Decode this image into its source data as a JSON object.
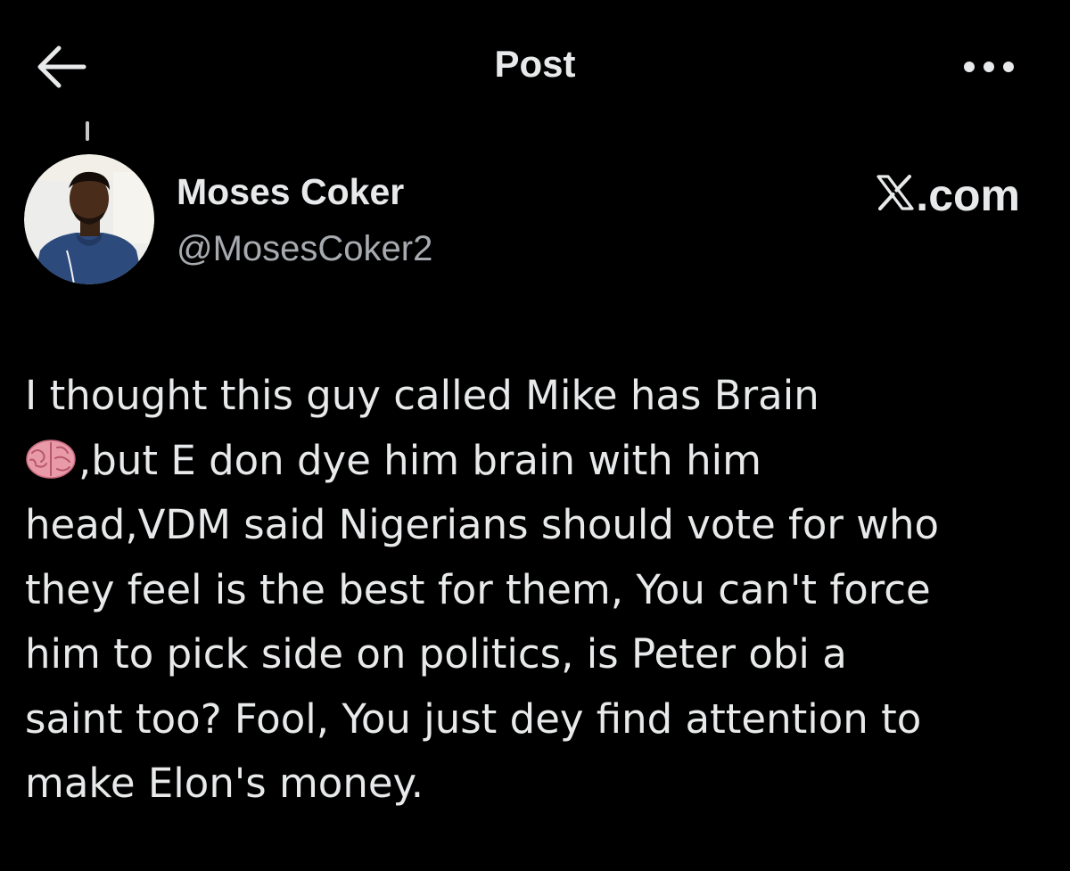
{
  "header": {
    "title": "Post",
    "back_icon": "arrow-left-icon",
    "more_icon": "more-horizontal-icon"
  },
  "author": {
    "name": "Moses Coker",
    "handle": "@MosesCoker2",
    "avatar_icon": "profile-photo"
  },
  "watermark": {
    "text": ".com",
    "logo_icon": "x-logo-icon"
  },
  "post": {
    "lines": [
      "I thought this guy called Mike has Brain",
      ",but E don dye him brain with him",
      "head,VDM said Nigerians should vote for who",
      "they feel is the best for them, You can't force",
      "him to pick side on politics, is Peter obi a",
      "saint too? Fool, You just dey find attention to",
      "make Elon's money."
    ],
    "emoji_icon": "brain-emoji-icon"
  },
  "colors": {
    "background": "#000000",
    "text_primary": "#e7e9ea",
    "text_secondary": "#a7abb0"
  }
}
